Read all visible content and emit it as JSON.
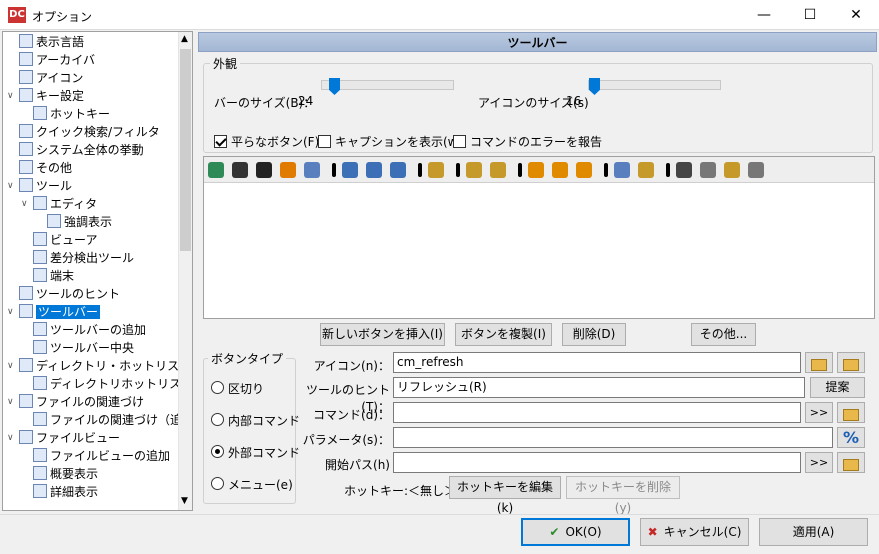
{
  "window": {
    "title": "オプション",
    "app_icon": "DC"
  },
  "tree": [
    {
      "label": "表示言語",
      "depth": 0,
      "icon": "monitor-icon"
    },
    {
      "label": "アーカイバ",
      "depth": 0,
      "icon": "archive-icon"
    },
    {
      "label": "アイコン",
      "depth": 0,
      "icon": "footprint-icon"
    },
    {
      "label": "キー設定",
      "depth": 0,
      "icon": "keyboard-icon",
      "expanded": true
    },
    {
      "label": "ホットキー",
      "depth": 1,
      "icon": "hotkey-icon"
    },
    {
      "label": "クイック検索/フィルタ",
      "depth": 0,
      "icon": "binoculars-icon"
    },
    {
      "label": "システム全体の挙動",
      "depth": 0,
      "icon": "system-icon"
    },
    {
      "label": "その他",
      "depth": 0,
      "icon": "misc-icon"
    },
    {
      "label": "ツール",
      "depth": 0,
      "icon": "tools-icon",
      "expanded": true
    },
    {
      "label": "エディタ",
      "depth": 1,
      "icon": "editor-icon",
      "expanded": true
    },
    {
      "label": "強調表示",
      "depth": 2,
      "icon": "highlight-icon"
    },
    {
      "label": "ビューア",
      "depth": 1,
      "icon": "viewer-icon"
    },
    {
      "label": "差分検出ツール",
      "depth": 1,
      "icon": "diff-icon"
    },
    {
      "label": "端末",
      "depth": 1,
      "icon": "terminal-icon"
    },
    {
      "label": "ツールのヒント",
      "depth": 0,
      "icon": "bulb-icon"
    },
    {
      "label": "ツールバー",
      "depth": 0,
      "icon": "toolbar-icon",
      "expanded": true,
      "selected": true
    },
    {
      "label": "ツールバーの追加",
      "depth": 1,
      "icon": "toolbar-add-icon"
    },
    {
      "label": "ツールバー中央",
      "depth": 1,
      "icon": "toolbar-center-icon"
    },
    {
      "label": "ディレクトリ・ホットリスト",
      "depth": 0,
      "icon": "folder-icon",
      "expanded": true
    },
    {
      "label": "ディレクトリホットリスト追加",
      "depth": 1,
      "icon": "folder-add-icon"
    },
    {
      "label": "ファイルの関連づけ",
      "depth": 0,
      "icon": "assoc-icon",
      "expanded": true
    },
    {
      "label": "ファイルの関連づけ（追加",
      "depth": 1,
      "icon": "assoc-add-icon"
    },
    {
      "label": "ファイルビュー",
      "depth": 0,
      "icon": "fileview-icon",
      "expanded": true
    },
    {
      "label": "ファイルビューの追加",
      "depth": 1,
      "icon": "fileview-add-icon"
    },
    {
      "label": "概要表示",
      "depth": 1,
      "icon": "brief-icon"
    },
    {
      "label": "詳細表示",
      "depth": 1,
      "icon": "full-icon"
    }
  ],
  "panel": {
    "title": "ツールバー"
  },
  "appearance": {
    "group_label": "外観",
    "bar_size_label": "バーのサイズ(B)：",
    "bar_size_value": "24",
    "icon_size_label": "アイコンのサイズ(s)",
    "icon_size_value": "16",
    "flat_buttons": {
      "label": "平らなボタン(F)",
      "checked": true
    },
    "show_captions": {
      "label": "キャプションを表示(w)",
      "checked": false
    },
    "report_errors": {
      "label": "コマンドのエラーを報告",
      "checked": false
    }
  },
  "toolbar_icons": [
    "refresh-icon",
    "terminal-icon",
    "console-icon",
    "tags-icon",
    "settings-icon",
    "sep",
    "view-columns-icon",
    "view-brief-icon",
    "view-thumbs-icon",
    "sep",
    "sync-icon",
    "sep",
    "copy-left-icon",
    "copy-right-icon",
    "sep",
    "add-icon",
    "remove-icon",
    "edit-icon",
    "sep",
    "pack-icon",
    "unpack-icon",
    "sep",
    "search-icon",
    "rename-icon",
    "folder-icon",
    "multi-icon"
  ],
  "actions": {
    "insert": "新しいボタンを挿入(I)",
    "duplicate": "ボタンを複製(I)",
    "delete": "削除(D)",
    "other": "その他..."
  },
  "button_type": {
    "group_label": "ボタンタイプ",
    "options": [
      "区切り",
      "内部コマンド",
      "外部コマンド",
      "メニュー(e)"
    ],
    "selected": "外部コマンド"
  },
  "form": {
    "icon_label": "アイコン(n)：",
    "icon_value": "cm_refresh",
    "hint_label": "ツールのヒント(T)：",
    "hint_value": "リフレッシュ(R)",
    "hint_button": "提案",
    "command_label": "コマンド(d)：",
    "command_value": "",
    "params_label": "パラメータ(s)：",
    "params_value": "",
    "start_path_label": "開始パス(h)",
    "start_path_value": "",
    "more_label": ">>",
    "percent_label": "%",
    "hotkey_label": "ホットキー:＜無し＞",
    "edit_hotkey": "ホットキーを編集(k)",
    "delete_hotkey": "ホットキーを削除(y)"
  },
  "footer": {
    "ok": "OK(O)",
    "cancel": "キャンセル(C)",
    "apply": "適用(A)"
  }
}
